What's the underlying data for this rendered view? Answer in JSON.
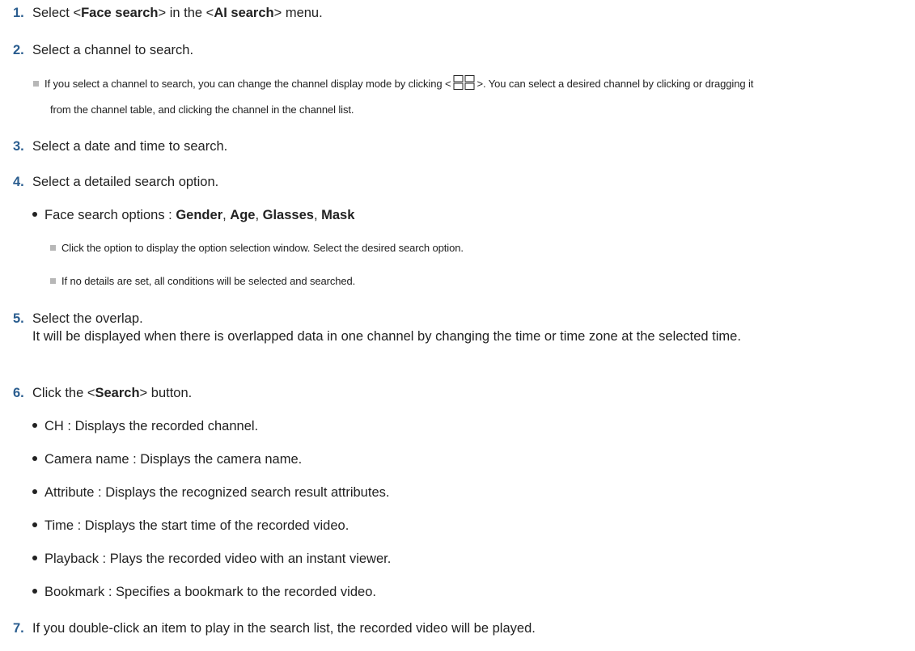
{
  "steps": {
    "s1": {
      "number": "1.",
      "pre": "Select <",
      "bold1": "Face search",
      "mid": "> in the <",
      "bold2": "AI search",
      "post": "> menu."
    },
    "s2": {
      "number": "2.",
      "text": "Select a channel to search."
    },
    "s3": {
      "number": "3.",
      "text": "Select a date and time to search."
    },
    "s4": {
      "number": "4.",
      "text": "Select a detailed search option."
    },
    "s5": {
      "number": "5.",
      "text": "Select the overlap.",
      "continuation": "It will be displayed when there is overlapped data in one channel by changing the time or time zone at the selected time."
    },
    "s6": {
      "number": "6.",
      "pre": "Click the <",
      "bold": "Search",
      "post": "> button."
    },
    "s7": {
      "number": "7.",
      "text": "If you double-click an item to play in the search list, the recorded video will be played."
    }
  },
  "notes": {
    "channel_mode": {
      "pre": "If you select a channel to search, you can change the channel display mode by clicking <",
      "icon": "display-mode-grid-icon",
      "post": ">. You can select a desired channel by clicking or dragging it",
      "line2": "from the channel table, and clicking the channel in the channel list."
    },
    "option_window": "Click the option to display the option selection window. Select the desired search option.",
    "no_details": "If no details are set, all conditions will be selected and searched."
  },
  "face_options": {
    "label": "Face search options : ",
    "gender": "Gender",
    "age": "Age",
    "glasses": "Glasses",
    "mask": "Mask",
    "sep": ", "
  },
  "result_columns": [
    "CH : Displays the recorded channel.",
    "Camera name : Displays the camera name.",
    "Attribute : Displays the recognized search result attributes.",
    "Time : Displays the start time of the recorded video.",
    "Playback : Plays the recorded video with an instant viewer.",
    "Bookmark : Specifies a bookmark to the recorded video."
  ],
  "colors": {
    "step_number": "#2a5d8f",
    "note_square": "#b7b7b7",
    "text": "#222222"
  }
}
